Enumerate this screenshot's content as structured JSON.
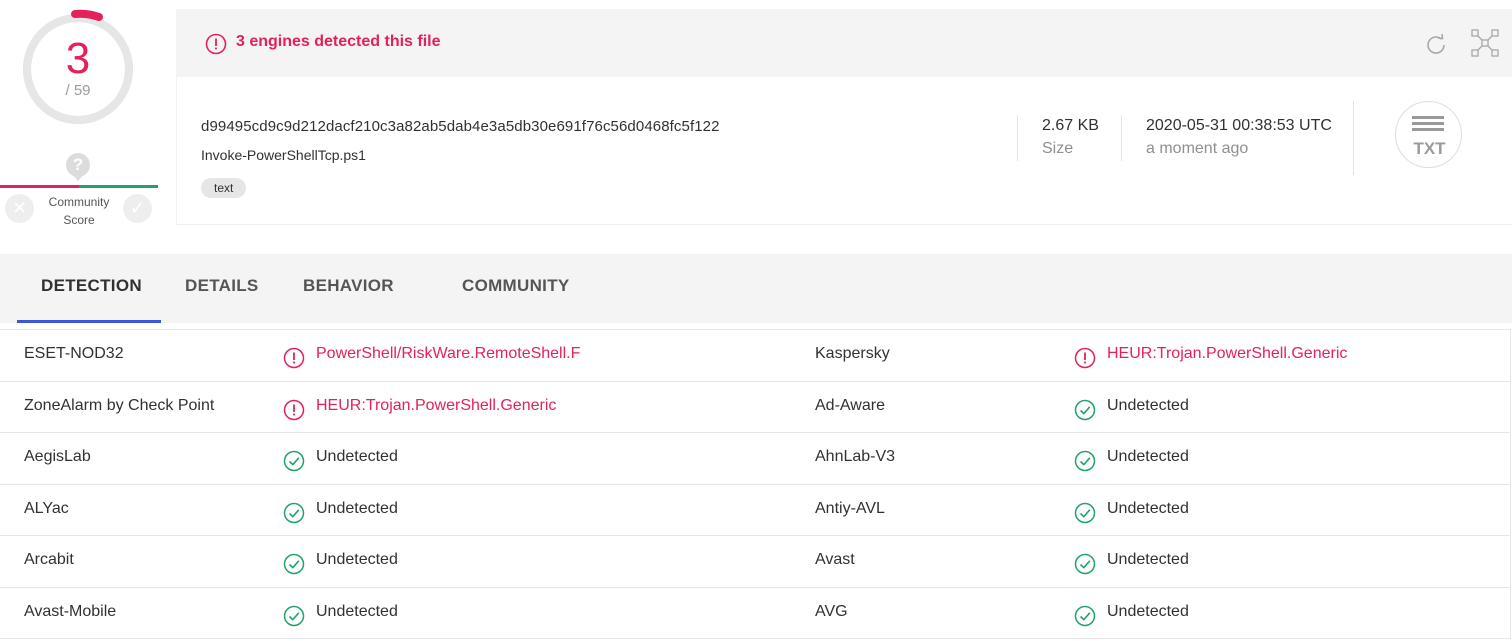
{
  "score": {
    "detections": "3",
    "total": "/ 59"
  },
  "community": {
    "question_mark": "?",
    "label_line1": "Community",
    "label_line2": "Score",
    "x_glyph": "✕",
    "check_glyph": "✓"
  },
  "banner": {
    "text": "3 engines detected this file"
  },
  "file": {
    "hash": "d99495cd9c9d212dacf210c3a82ab5dab4e3a5db30e691f76c56d0468fc5f122",
    "name": "Invoke-PowerShellTcp.ps1",
    "tag": "text",
    "size_value": "2.67 KB",
    "size_label": "Size",
    "date_value": "2020-05-31 00:38:53 UTC",
    "date_label": "a moment ago",
    "type_label": "TXT"
  },
  "tabs": [
    {
      "label": "DETECTION",
      "active": true
    },
    {
      "label": "DETAILS",
      "active": false
    },
    {
      "label": "BEHAVIOR",
      "active": false
    },
    {
      "label": "COMMUNITY",
      "active": false
    }
  ],
  "detections": [
    {
      "left_engine": "ESET-NOD32",
      "left_result": "PowerShell/RiskWare.RemoteShell.F",
      "left_status": "malicious",
      "right_engine": "Kaspersky",
      "right_result": "HEUR:Trojan.PowerShell.Generic",
      "right_status": "malicious"
    },
    {
      "left_engine": "ZoneAlarm by Check Point",
      "left_result": "HEUR:Trojan.PowerShell.Generic",
      "left_status": "malicious",
      "right_engine": "Ad-Aware",
      "right_result": "Undetected",
      "right_status": "undetected"
    },
    {
      "left_engine": "AegisLab",
      "left_result": "Undetected",
      "left_status": "undetected",
      "right_engine": "AhnLab-V3",
      "right_result": "Undetected",
      "right_status": "undetected"
    },
    {
      "left_engine": "ALYac",
      "left_result": "Undetected",
      "left_status": "undetected",
      "right_engine": "Antiy-AVL",
      "right_result": "Undetected",
      "right_status": "undetected"
    },
    {
      "left_engine": "Arcabit",
      "left_result": "Undetected",
      "left_status": "undetected",
      "right_engine": "Avast",
      "right_result": "Undetected",
      "right_status": "undetected"
    },
    {
      "left_engine": "Avast-Mobile",
      "left_result": "Undetected",
      "left_status": "undetected",
      "right_engine": "AVG",
      "right_result": "Undetected",
      "right_status": "undetected"
    }
  ],
  "colors": {
    "malicious": "#e4215a",
    "clean": "#20a36a",
    "accent": "#3b56d9"
  }
}
